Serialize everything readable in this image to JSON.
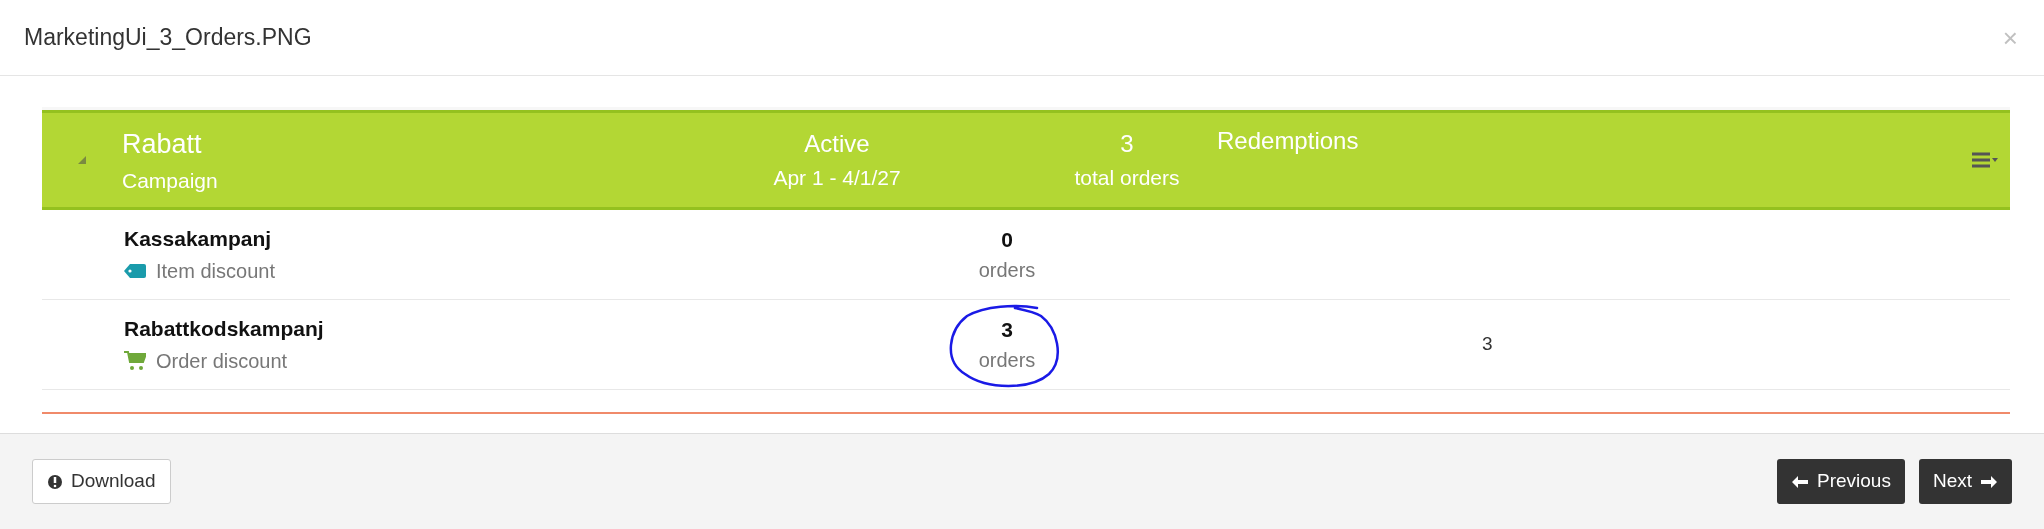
{
  "dialog": {
    "title": "MarketingUi_3_Orders.PNG",
    "close": "×"
  },
  "header": {
    "expanded": true,
    "name": "Rabatt",
    "subtitle": "Campaign",
    "status": "Active",
    "dates": "Apr 1 - 4/1/27",
    "total": "3",
    "total_label": "total orders",
    "redemptions": "Redemptions"
  },
  "rows": [
    {
      "name": "Kassakampanj",
      "kind": "tag",
      "type": "Item discount",
      "orders": "0",
      "orders_label": "orders",
      "redemptions": "",
      "circled": false
    },
    {
      "name": "Rabattkodskampanj",
      "kind": "cart",
      "type": "Order discount",
      "orders": "3",
      "orders_label": "orders",
      "redemptions": "3",
      "circled": true
    }
  ],
  "footer": {
    "download": "Download",
    "previous": "Previous",
    "next": "Next"
  }
}
